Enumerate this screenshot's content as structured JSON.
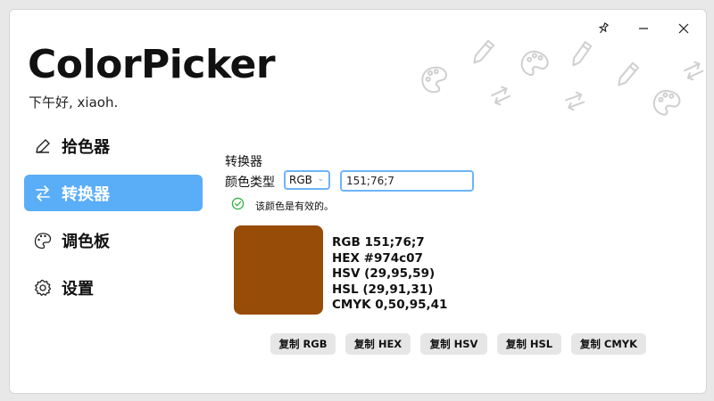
{
  "window": {
    "pin_icon": "pin-icon",
    "minimize_icon": "minimize-icon",
    "close_icon": "close-icon"
  },
  "header": {
    "title": "ColorPicker",
    "greeting": "下午好, xiaoh."
  },
  "sidebar": {
    "items": [
      {
        "label": "拾色器",
        "icon": "pencil-icon",
        "active": false
      },
      {
        "label": "转换器",
        "icon": "swap-arrows-icon",
        "active": true
      },
      {
        "label": "调色板",
        "icon": "palette-icon",
        "active": false
      },
      {
        "label": "设置",
        "icon": "gear-icon",
        "active": false
      }
    ]
  },
  "converter": {
    "section_title": "转换器",
    "type_label": "颜色类型",
    "type_selected": "RGB",
    "input_value": "151;76;7",
    "valid_message": "该颜色是有效的。",
    "color_hex": "#974c07",
    "values": [
      "RGB 151;76;7",
      "HEX #974c07",
      "HSV (29,95,59)",
      "HSL (29,91,31)",
      "CMYK 0,50,95,41"
    ],
    "copy_buttons": [
      "复制 RGB",
      "复制 HEX",
      "复制 HSV",
      "复制 HSL",
      "复制 CMYK"
    ]
  },
  "colors": {
    "accent": "#5aadf7",
    "valid_green": "#2fb344",
    "swatch": "#974c07"
  }
}
